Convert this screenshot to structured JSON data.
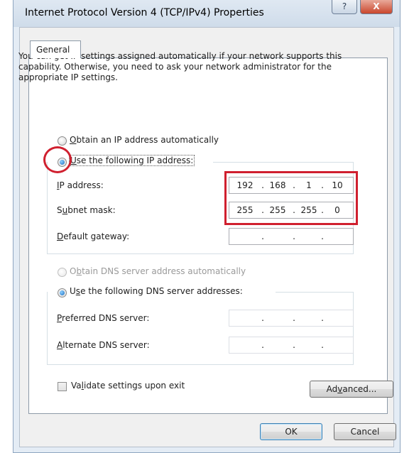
{
  "window": {
    "title": "Internet Protocol Version 4 (TCP/IPv4) Properties",
    "help_glyph": "?",
    "close_glyph": "X"
  },
  "tabs": [
    {
      "label": "General",
      "selected": true
    }
  ],
  "description": "You can get IP settings assigned automatically if your network supports this capability. Otherwise, you need to ask your network administrator for the appropriate IP settings.",
  "ip_options": {
    "auto_label": "Obtain an IP address automatically",
    "manual_label": "Use the following IP address:",
    "selected": "manual"
  },
  "ip_fields": {
    "ip_address": {
      "label": "IP address:",
      "octets": [
        "192",
        "168",
        "1",
        "10"
      ]
    },
    "subnet_mask": {
      "label": "Subnet mask:",
      "octets": [
        "255",
        "255",
        "255",
        "0"
      ]
    },
    "default_gateway": {
      "label": "Default gateway:",
      "octets": [
        "",
        "",
        "",
        ""
      ]
    }
  },
  "dns_options": {
    "auto_label": "Obtain DNS server address automatically",
    "manual_label": "Use the following DNS server addresses:",
    "selected": "manual",
    "auto_disabled": true
  },
  "dns_fields": {
    "preferred": {
      "label": "Preferred DNS server:",
      "octets": [
        "",
        "",
        "",
        ""
      ]
    },
    "alternate": {
      "label": "Alternate DNS server:",
      "octets": [
        "",
        "",
        "",
        ""
      ]
    }
  },
  "validate": {
    "label": "Validate settings upon exit",
    "checked": false
  },
  "buttons": {
    "advanced": "Advanced...",
    "ok": "OK",
    "cancel": "Cancel"
  },
  "colors": {
    "highlight_red": "#d0202f",
    "radio_blue": "#1c6fc2"
  }
}
